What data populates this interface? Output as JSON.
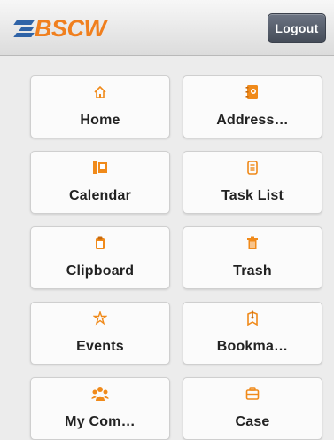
{
  "header": {
    "logo_text": "BSCW",
    "logout_label": "Logout"
  },
  "tiles": [
    {
      "label": "Home",
      "icon": "home-icon"
    },
    {
      "label": "Address…",
      "icon": "address-book-icon"
    },
    {
      "label": "Calendar",
      "icon": "calendar-icon"
    },
    {
      "label": "Task List",
      "icon": "task-list-icon"
    },
    {
      "label": "Clipboard",
      "icon": "clipboard-icon"
    },
    {
      "label": "Trash",
      "icon": "trash-icon"
    },
    {
      "label": "Events",
      "icon": "events-icon"
    },
    {
      "label": "Bookma…",
      "icon": "bookmark-icon"
    },
    {
      "label": "My Com…",
      "icon": "community-icon"
    },
    {
      "label": "Case",
      "icon": "case-icon"
    }
  ],
  "colors": {
    "accent": "#f08a1a",
    "logo_blue": "#2f63a7",
    "logo_orange": "#f07f1e",
    "button_dark": "#4f5663"
  }
}
